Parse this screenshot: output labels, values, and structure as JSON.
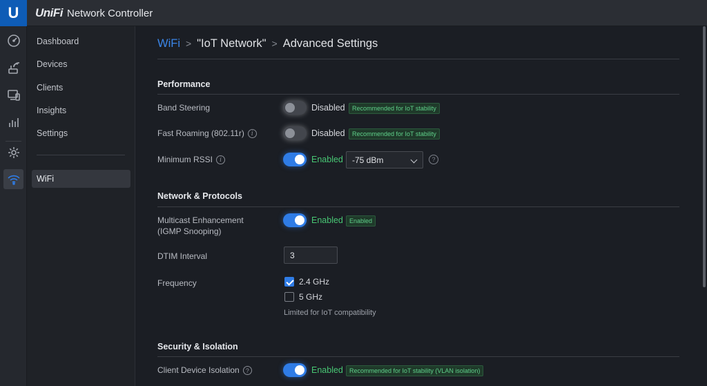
{
  "app": {
    "logo_letter": "U",
    "brand": "UniFi",
    "title": "Network Controller"
  },
  "rail_icons": [
    "dashboard-icon",
    "devices-icon",
    "clients-icon",
    "insights-icon",
    "settings-icon",
    "wifi-icon"
  ],
  "nav": {
    "items": [
      "Dashboard",
      "Devices",
      "Clients",
      "Insights",
      "Settings"
    ],
    "active": "WiFi"
  },
  "breadcrumb": {
    "root": "WiFi",
    "network": "\"IoT Network\"",
    "page": "Advanced Settings",
    "separator": ">"
  },
  "sections": {
    "performance": "Performance",
    "network": "Network & Protocols",
    "security": "Security & Isolation"
  },
  "band_steering": {
    "label": "Band Steering",
    "enabled": false,
    "state": "Disabled",
    "badge": "Recommended for IoT stability"
  },
  "fast_roaming": {
    "label": "Fast Roaming (802.11r)",
    "enabled": false,
    "state": "Disabled",
    "badge": "Recommended for IoT stability"
  },
  "min_rssi": {
    "label": "Minimum RSSI",
    "enabled": true,
    "state": "Enabled",
    "value": "-75 dBm"
  },
  "multicast": {
    "label_line1": "Multicast Enhancement",
    "label_line2": "(IGMP Snooping)",
    "enabled": true,
    "state": "Enabled",
    "badge": "Enabled"
  },
  "dtim": {
    "label": "DTIM Interval",
    "value": "3"
  },
  "frequency": {
    "label": "Frequency",
    "options": [
      {
        "label": "2.4 GHz",
        "checked": true
      },
      {
        "label": "5 GHz",
        "checked": false
      }
    ],
    "hint": "Limited for IoT compatibility"
  },
  "client_isolation": {
    "label": "Client Device Isolation",
    "enabled": true,
    "state": "Enabled",
    "badge": "Recommended for IoT stability (VLAN isolation)"
  },
  "icons": {
    "info": "i",
    "help": "?"
  },
  "colors": {
    "accent": "#2f7ce6",
    "enabled_green": "#48c774",
    "logo_blue": "#0e5cb6"
  }
}
